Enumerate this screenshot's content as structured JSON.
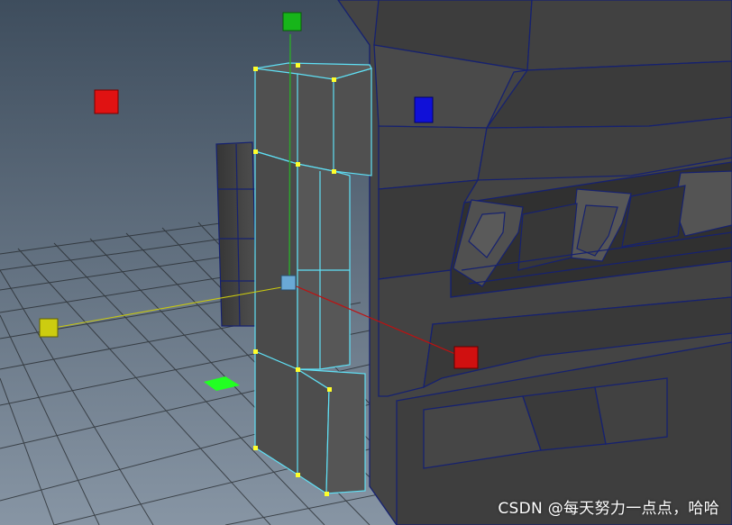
{
  "viewport": {
    "background_top": "#3e4d5d",
    "background_bottom": "#8795a4",
    "wire_color": "#5fe0f5",
    "vertex_color": "#ffff2a",
    "mesh_edge_color": "#16216f"
  },
  "manipulator": {
    "x_handle_color": "#d01010",
    "y_handle_color": "#17b51a",
    "z_handle_color": "#1010d8",
    "view_handle_color": "#cccc10",
    "center_handle_color": "#6aa9d6",
    "plane_handle_color": "#22ff22"
  },
  "watermark": "CSDN @每天努力一点点，哈哈"
}
